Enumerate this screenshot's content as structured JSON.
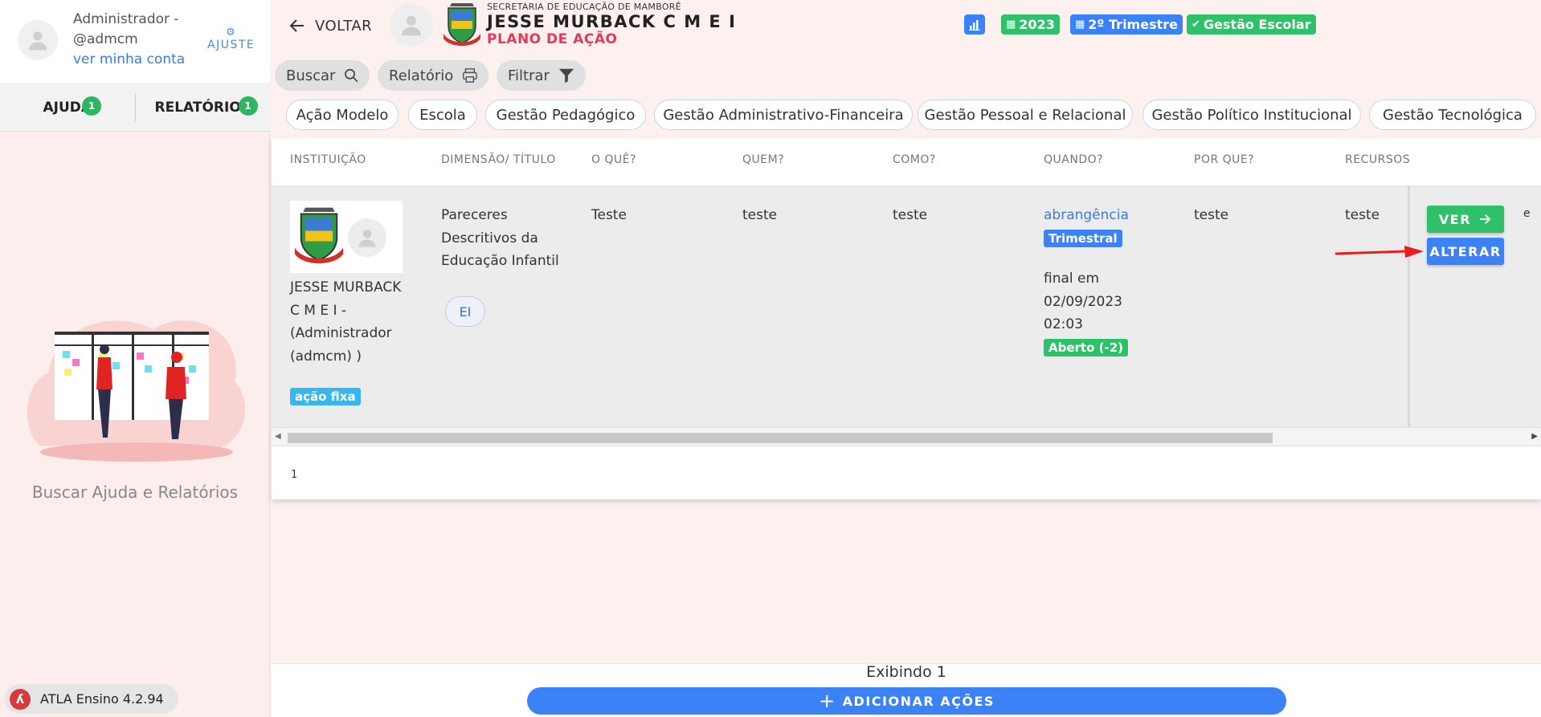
{
  "sidebar": {
    "user_name": "Administrador - @admcm",
    "account_link": "ver minha conta",
    "settings_label": "AJUSTE",
    "tabs": [
      {
        "label": "AJUDA",
        "badge": "1"
      },
      {
        "label": "RELATÓRIOS",
        "badge": "1"
      }
    ],
    "help_text": "Buscar Ajuda e Relatórios",
    "version": "ATLA Ensino 4.2.94"
  },
  "header": {
    "back_label": "VOLTAR",
    "secretaria": "SECRETARIA DE EDUCAÇÃO DE MAMBORÊ",
    "school_name": "JESSE MURBACK C M E I",
    "plan_title": "PLANO DE AÇÃO",
    "badges": {
      "chart_icon": "bar-chart-icon",
      "year": "2023",
      "term": "2º Trimestre",
      "management": "Gestão Escolar"
    },
    "colors": {
      "blue": "#3b82f6",
      "green": "#2fc16a",
      "red_title": "#e23b5a"
    }
  },
  "toolbar": {
    "search": "Buscar",
    "report": "Relatório",
    "filter": "Filtrar"
  },
  "chips": [
    "Ação Modelo",
    "Escola",
    "Gestão Pedagógico",
    "Gestão Administrativo-Financeira",
    "Gestão Pessoal e Relacional",
    "Gestão Político Institucional",
    "Gestão Tecnológica"
  ],
  "table": {
    "columns": [
      "INSTITUIÇÃO",
      "DIMENSÃO/ TÍTULO",
      "O QUÊ?",
      "QUEM?",
      "COMO?",
      "QUANDO?",
      "POR QUE?",
      "RECURSOS"
    ],
    "row": {
      "institution": "JESSE MURBACK C M E I - (Administrador (admcm) )",
      "fixed_tag": "ação fixa",
      "title": "Pareceres Descritivos da Educação Infantil",
      "title_chip": "EI",
      "what": "Teste",
      "who": "teste",
      "how": "teste",
      "when_link": "abrangência",
      "when_period": "Trimestral",
      "when_end_label": "final em",
      "when_date": "02/09/2023",
      "when_time": "02:03",
      "when_status": "Aberto (-2)",
      "why": "teste",
      "resources": "teste",
      "overflow": "e",
      "view_label": "VER",
      "edit_label": "ALTERAR"
    },
    "page": "1"
  },
  "footer": {
    "showing": "Exibindo 1",
    "add_label": "ADICIONAR AÇÕES"
  }
}
